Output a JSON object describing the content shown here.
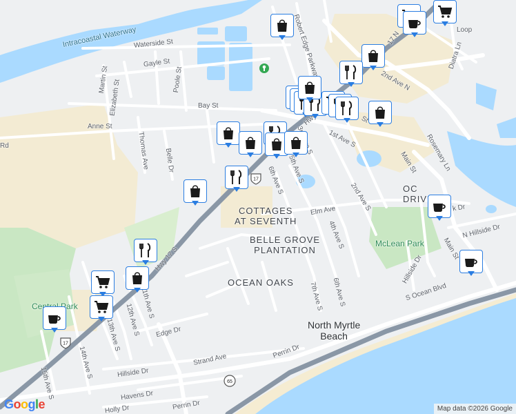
{
  "map": {
    "water_label": "Intracoastal Waterway",
    "streets": {
      "waterside": "Waterside St",
      "gayle": "Gayle St",
      "martin": "Martin St",
      "elizabeth": "Elizabeth St",
      "poole": "Poole St",
      "bay": "Bay St",
      "anne": "Anne St",
      "thomas": "Thomas Ave",
      "belle": "Belle Dr",
      "rd": "Rd",
      "hwy17s": "Hwy 17 S",
      "hwy_upper": "Hwy",
      "robert_edge": "Robert Edge Parkway",
      "first_ave_s": "1st Ave S",
      "st_ne": "St",
      "second_ave_s": "2nd Ave S",
      "main_st": "Main St",
      "loop": "Loop",
      "diatra": "Diatra Ln",
      "ave_n": "2nd Ave N",
      "n17": "17 N",
      "rosemary": "Rosemary Ln",
      "third_ave": "3rd Ave S",
      "fourth_ave": "4th Ave S",
      "fifth_ave": "5th Ave S",
      "sixth_ave": "6th Ave S",
      "sixth_ave_2": "6th Ave S",
      "seventh_ave": "7th Ave S",
      "elm": "Elm Ave",
      "nk_dr": "k Dr",
      "n_hillside": "N Hillside Dr",
      "hillside_dr_r": "Hillside Dr",
      "main_st_s": "Main St",
      "s_ocean": "S Ocean Blvd",
      "eleventh": "11th Ave S",
      "twelfth": "12th Ave S",
      "thirteenth": "13th Ave S",
      "fourteenth": "14th Ave S",
      "fifteenth": "15th Ave S",
      "edge_dr": "Edge Dr",
      "hillside_dr": "Hillside Dr",
      "strand": "Strand Ave",
      "havens": "Havens Dr",
      "perrin_dr": "Perrin Dr",
      "perrin_dr_2": "Perrin Dr",
      "holly": "Holly Dr"
    },
    "areas": {
      "cottages_1": "COTTAGES",
      "cottages_2": "AT SEVENTH",
      "belle_grove_1": "BELLE GROVE",
      "belle_grove_2": "PLANTATION",
      "ocean_oaks": "OCEAN OAKS",
      "ocean_drive_1": "OC",
      "ocean_drive_2": "DRIVE"
    },
    "city_1": "North Myrtle",
    "city_2": "Beach",
    "parks": {
      "mclean": "McLean Park",
      "central": "Central Park"
    },
    "shields": {
      "us17_a": "17",
      "us17_b": "17",
      "sc65": "65"
    },
    "attribution": "Map data ©2026 Google",
    "logo": "Google"
  },
  "pins": [
    {
      "type": "shopping",
      "name": "shopping-pin"
    },
    {
      "type": "grocery",
      "name": "grocery-pin"
    },
    {
      "type": "grocery",
      "name": "grocery-pin"
    },
    {
      "type": "cafe",
      "name": "cafe-pin"
    },
    {
      "type": "shopping",
      "name": "shopping-pin"
    },
    {
      "type": "restaurant",
      "name": "restaurant-pin"
    },
    {
      "type": "restaurant",
      "name": "restaurant-pin"
    },
    {
      "type": "restaurant",
      "name": "restaurant-pin"
    },
    {
      "type": "restaurant",
      "name": "restaurant-pin"
    },
    {
      "type": "restaurant",
      "name": "restaurant-pin"
    },
    {
      "type": "shopping",
      "name": "shopping-pin"
    },
    {
      "type": "grocery",
      "name": "grocery-pin"
    },
    {
      "type": "shopping",
      "name": "shopping-pin"
    },
    {
      "type": "restaurant",
      "name": "restaurant-pin"
    },
    {
      "type": "restaurant",
      "name": "restaurant-pin"
    },
    {
      "type": "shopping",
      "name": "shopping-pin"
    },
    {
      "type": "restaurant",
      "name": "restaurant-pin"
    },
    {
      "type": "shopping",
      "name": "shopping-pin"
    },
    {
      "type": "shopping",
      "name": "shopping-pin"
    },
    {
      "type": "shopping",
      "name": "shopping-pin"
    },
    {
      "type": "restaurant",
      "name": "restaurant-pin"
    },
    {
      "type": "shopping",
      "name": "shopping-pin"
    },
    {
      "type": "cafe",
      "name": "cafe-pin"
    },
    {
      "type": "cafe",
      "name": "cafe-pin"
    },
    {
      "type": "restaurant",
      "name": "restaurant-pin"
    },
    {
      "type": "grocery",
      "name": "grocery-pin"
    },
    {
      "type": "shopping",
      "name": "shopping-pin"
    },
    {
      "type": "grocery",
      "name": "grocery-pin"
    },
    {
      "type": "cafe",
      "name": "cafe-pin"
    }
  ],
  "colors": {
    "water": "#aadaff",
    "park": "#c8e6c0",
    "sand": "#f5ecd2",
    "road": "#ffffff",
    "highway": "#8a97a6",
    "pin_border": "#2a7de1"
  }
}
